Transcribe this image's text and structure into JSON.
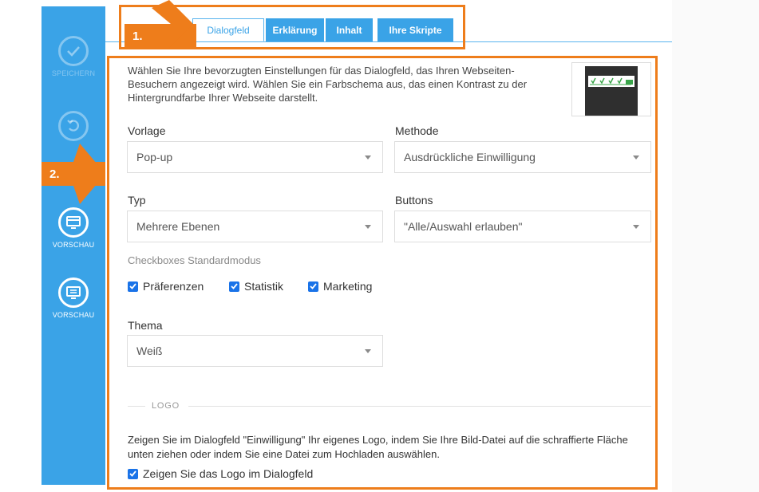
{
  "sidebar": {
    "buttons": [
      {
        "label": "SPEICHERN",
        "icon": "check-icon",
        "enabled": false
      },
      {
        "label": "",
        "icon": "undo-icon",
        "enabled": false
      },
      {
        "label": "VORSCHAU",
        "icon": "monitor-preview-icon",
        "enabled": true
      },
      {
        "label": "VORSCHAU",
        "icon": "monitor-list-icon",
        "enabled": true
      }
    ]
  },
  "tabs": [
    {
      "label": "Dialogfeld",
      "active": true
    },
    {
      "label": "Erklärung",
      "active": false
    },
    {
      "label": "Inhalt",
      "active": false
    },
    {
      "label": "Ihre Skripte",
      "active": false
    }
  ],
  "intro_text": "Wählen Sie Ihre bevorzugten Einstellungen für das Dialogfeld, das Ihren Webseiten-Besuchern angezeigt wird. Wählen Sie ein Farbschema aus, das einen Kontrast zu der Hintergrundfarbe Ihrer Webseite darstellt.",
  "fields": {
    "vorlage": {
      "label": "Vorlage",
      "value": "Pop-up"
    },
    "methode": {
      "label": "Methode",
      "value": "Ausdrückliche Einwilligung"
    },
    "typ": {
      "label": "Typ",
      "value": "Mehrere Ebenen"
    },
    "buttons": {
      "label": "Buttons",
      "value": "\"Alle/Auswahl erlauben\""
    },
    "thema": {
      "label": "Thema",
      "value": "Weiß"
    }
  },
  "checkboxes_section": {
    "label": "Checkboxes Standardmodus",
    "items": [
      {
        "label": "Präferenzen",
        "checked": true
      },
      {
        "label": "Statistik",
        "checked": true
      },
      {
        "label": "Marketing",
        "checked": true
      }
    ]
  },
  "logo_section": {
    "heading": "LOGO",
    "description": "Zeigen Sie im Dialogfeld \"Einwilligung\" Ihr eigenes Logo, indem Sie Ihre Bild-Datei auf die schraffierte Fläche unten ziehen oder indem Sie eine Datei zum Hochladen auswählen.",
    "show_logo": {
      "label": "Zeigen Sie das Logo im Dialogfeld",
      "checked": true
    }
  },
  "annotations": {
    "step1": "1.",
    "step2": "2."
  },
  "colors": {
    "sidebar": "#3aa3e7",
    "accent": "#1a73e8",
    "annotation": "#ee7d1b"
  }
}
